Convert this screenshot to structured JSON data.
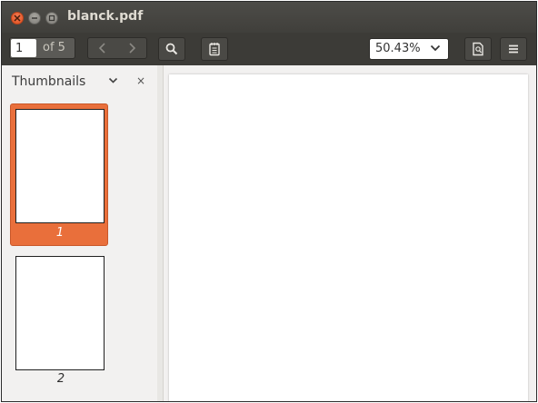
{
  "window": {
    "title": "blanck.pdf"
  },
  "toolbar": {
    "page_current": "1",
    "page_total_label": "of 5",
    "zoom_value": "50.43%",
    "icons": {
      "prev": "chevron-left-icon",
      "next": "chevron-right-icon",
      "search": "search-icon",
      "annotations": "notepad-icon",
      "zoom_dropdown": "chevron-down-icon",
      "bookmarks": "document-bookmark-icon",
      "menu": "hamburger-menu-icon"
    }
  },
  "sidebar": {
    "title": "Thumbnails",
    "close_label": "×",
    "thumbnails": [
      {
        "label": "1",
        "selected": true
      },
      {
        "label": "2",
        "selected": false
      }
    ]
  },
  "colors": {
    "titlebar": "#403f3b",
    "toolbar": "#3c3b37",
    "accent": "#e96f3b",
    "close_button": "#e0501f"
  }
}
